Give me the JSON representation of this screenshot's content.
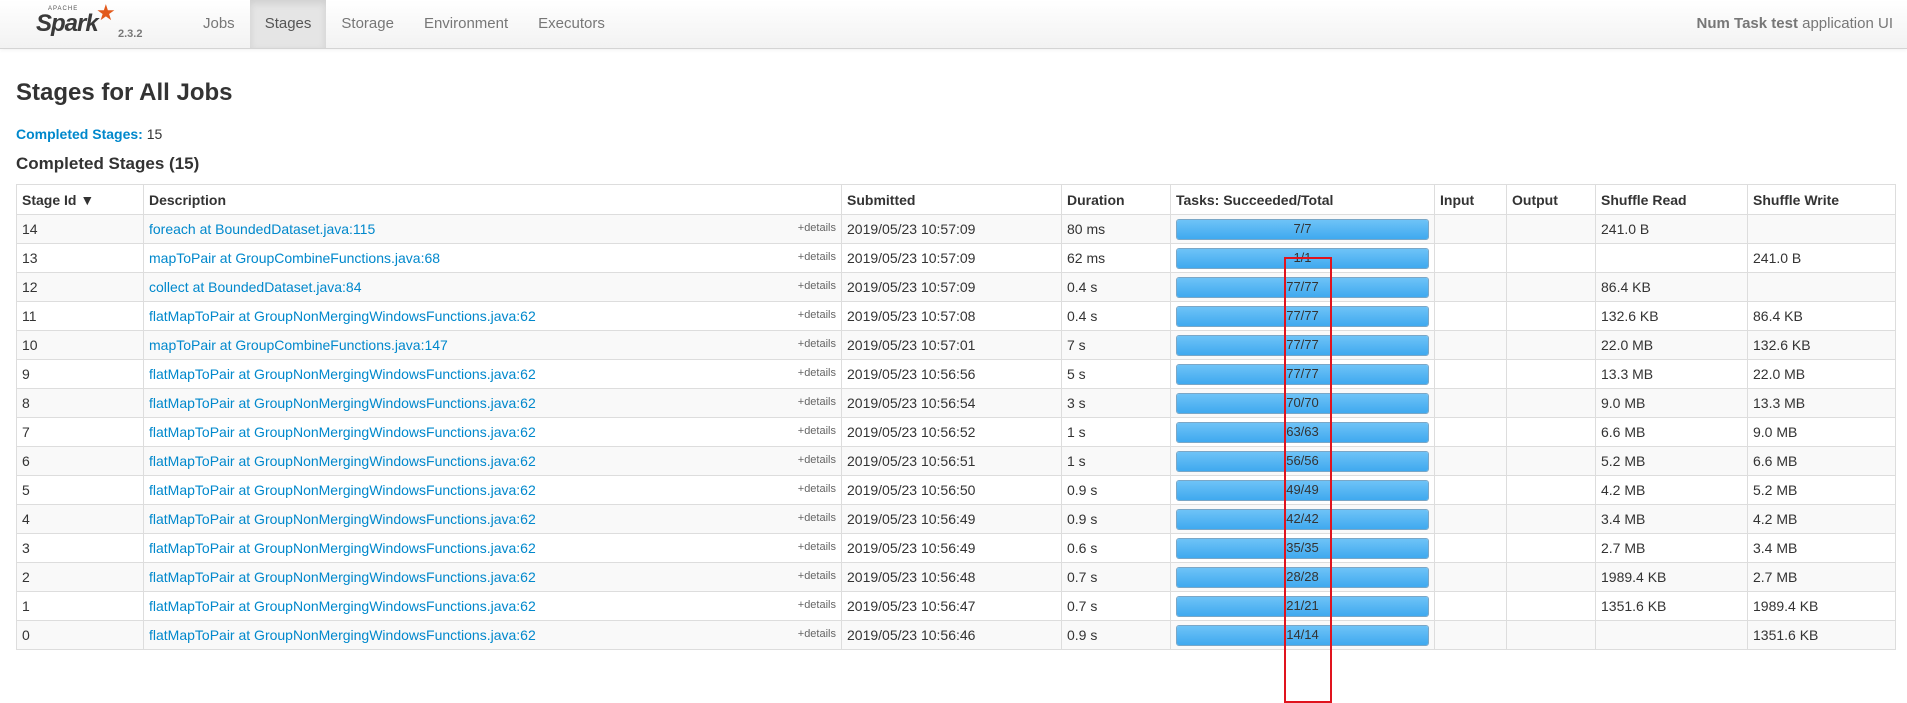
{
  "brand": {
    "apache": "APACHE",
    "name": "Spark",
    "version": "2.3.2"
  },
  "nav": {
    "tabs": [
      "Jobs",
      "Stages",
      "Storage",
      "Environment",
      "Executors"
    ],
    "active": "Stages"
  },
  "app": {
    "name": "Num Task test",
    "suffix": " application UI"
  },
  "page": {
    "title": "Stages for All Jobs",
    "summary_label": "Completed Stages:",
    "summary_value": " 15",
    "section_title": "Completed Stages (15)"
  },
  "table": {
    "headers": [
      "Stage Id ▼",
      "Description",
      "Submitted",
      "Duration",
      "Tasks: Succeeded/Total",
      "Input",
      "Output",
      "Shuffle Read",
      "Shuffle Write"
    ],
    "details_label": "+details",
    "rows": [
      {
        "id": "14",
        "desc": "foreach at BoundedDataset.java:115",
        "submitted": "2019/05/23 10:57:09",
        "duration": "80 ms",
        "tasks": "7/7",
        "progress": 1.0,
        "input": "",
        "output": "",
        "shuffle_read": "241.0 B",
        "shuffle_write": ""
      },
      {
        "id": "13",
        "desc": "mapToPair at GroupCombineFunctions.java:68",
        "submitted": "2019/05/23 10:57:09",
        "duration": "62 ms",
        "tasks": "1/1",
        "progress": 1.0,
        "input": "",
        "output": "",
        "shuffle_read": "",
        "shuffle_write": "241.0 B"
      },
      {
        "id": "12",
        "desc": "collect at BoundedDataset.java:84",
        "submitted": "2019/05/23 10:57:09",
        "duration": "0.4 s",
        "tasks": "77/77",
        "progress": 1.0,
        "input": "",
        "output": "",
        "shuffle_read": "86.4 KB",
        "shuffle_write": ""
      },
      {
        "id": "11",
        "desc": "flatMapToPair at GroupNonMergingWindowsFunctions.java:62",
        "submitted": "2019/05/23 10:57:08",
        "duration": "0.4 s",
        "tasks": "77/77",
        "progress": 1.0,
        "input": "",
        "output": "",
        "shuffle_read": "132.6 KB",
        "shuffle_write": "86.4 KB"
      },
      {
        "id": "10",
        "desc": "mapToPair at GroupCombineFunctions.java:147",
        "submitted": "2019/05/23 10:57:01",
        "duration": "7 s",
        "tasks": "77/77",
        "progress": 1.0,
        "input": "",
        "output": "",
        "shuffle_read": "22.0 MB",
        "shuffle_write": "132.6 KB"
      },
      {
        "id": "9",
        "desc": "flatMapToPair at GroupNonMergingWindowsFunctions.java:62",
        "submitted": "2019/05/23 10:56:56",
        "duration": "5 s",
        "tasks": "77/77",
        "progress": 1.0,
        "input": "",
        "output": "",
        "shuffle_read": "13.3 MB",
        "shuffle_write": "22.0 MB"
      },
      {
        "id": "8",
        "desc": "flatMapToPair at GroupNonMergingWindowsFunctions.java:62",
        "submitted": "2019/05/23 10:56:54",
        "duration": "3 s",
        "tasks": "70/70",
        "progress": 1.0,
        "input": "",
        "output": "",
        "shuffle_read": "9.0 MB",
        "shuffle_write": "13.3 MB"
      },
      {
        "id": "7",
        "desc": "flatMapToPair at GroupNonMergingWindowsFunctions.java:62",
        "submitted": "2019/05/23 10:56:52",
        "duration": "1 s",
        "tasks": "63/63",
        "progress": 1.0,
        "input": "",
        "output": "",
        "shuffle_read": "6.6 MB",
        "shuffle_write": "9.0 MB"
      },
      {
        "id": "6",
        "desc": "flatMapToPair at GroupNonMergingWindowsFunctions.java:62",
        "submitted": "2019/05/23 10:56:51",
        "duration": "1 s",
        "tasks": "56/56",
        "progress": 1.0,
        "input": "",
        "output": "",
        "shuffle_read": "5.2 MB",
        "shuffle_write": "6.6 MB"
      },
      {
        "id": "5",
        "desc": "flatMapToPair at GroupNonMergingWindowsFunctions.java:62",
        "submitted": "2019/05/23 10:56:50",
        "duration": "0.9 s",
        "tasks": "49/49",
        "progress": 1.0,
        "input": "",
        "output": "",
        "shuffle_read": "4.2 MB",
        "shuffle_write": "5.2 MB"
      },
      {
        "id": "4",
        "desc": "flatMapToPair at GroupNonMergingWindowsFunctions.java:62",
        "submitted": "2019/05/23 10:56:49",
        "duration": "0.9 s",
        "tasks": "42/42",
        "progress": 1.0,
        "input": "",
        "output": "",
        "shuffle_read": "3.4 MB",
        "shuffle_write": "4.2 MB"
      },
      {
        "id": "3",
        "desc": "flatMapToPair at GroupNonMergingWindowsFunctions.java:62",
        "submitted": "2019/05/23 10:56:49",
        "duration": "0.6 s",
        "tasks": "35/35",
        "progress": 1.0,
        "input": "",
        "output": "",
        "shuffle_read": "2.7 MB",
        "shuffle_write": "3.4 MB"
      },
      {
        "id": "2",
        "desc": "flatMapToPair at GroupNonMergingWindowsFunctions.java:62",
        "submitted": "2019/05/23 10:56:48",
        "duration": "0.7 s",
        "tasks": "28/28",
        "progress": 1.0,
        "input": "",
        "output": "",
        "shuffle_read": "1989.4 KB",
        "shuffle_write": "2.7 MB"
      },
      {
        "id": "1",
        "desc": "flatMapToPair at GroupNonMergingWindowsFunctions.java:62",
        "submitted": "2019/05/23 10:56:47",
        "duration": "0.7 s",
        "tasks": "21/21",
        "progress": 1.0,
        "input": "",
        "output": "",
        "shuffle_read": "1351.6 KB",
        "shuffle_write": "1989.4 KB"
      },
      {
        "id": "0",
        "desc": "flatMapToPair at GroupNonMergingWindowsFunctions.java:62",
        "submitted": "2019/05/23 10:56:46",
        "duration": "0.9 s",
        "tasks": "14/14",
        "progress": 1.0,
        "input": "",
        "output": "",
        "shuffle_read": "",
        "shuffle_write": "1351.6 KB"
      }
    ]
  },
  "annotation": {
    "highlight_color": "#e0141e",
    "accent_color": "#0088cc",
    "bar_color": "#3fa9ef"
  }
}
